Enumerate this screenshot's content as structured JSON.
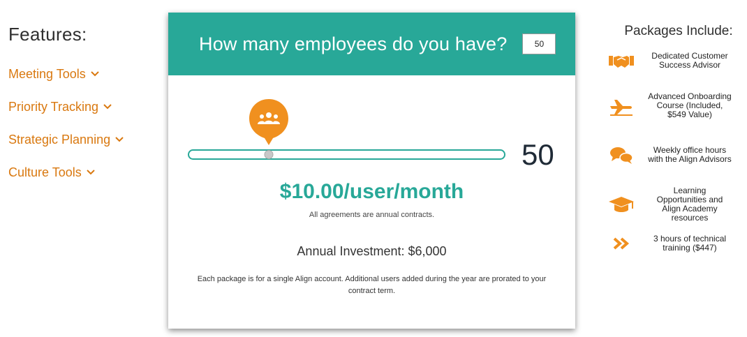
{
  "features": {
    "title": "Features:",
    "items": [
      {
        "label": "Meeting Tools"
      },
      {
        "label": "Priority Tracking"
      },
      {
        "label": "Strategic Planning"
      },
      {
        "label": "Culture Tools"
      }
    ]
  },
  "calculator": {
    "question": "How many employees do you have?",
    "employee_input_value": "50",
    "employee_count_display": "50",
    "slider_fraction": 0.255,
    "price_per_user": "$10.00/user/month",
    "contract_note": "All agreements are annual contracts.",
    "annual_investment": "Annual Investment: $6,000",
    "package_note": "Each package is for a single Align account. Additional users added during the year are prorated to your contract term."
  },
  "packages": {
    "title": "Packages Include:",
    "items": [
      {
        "icon": "handshake-icon",
        "label": "Dedicated Customer Success Advisor"
      },
      {
        "icon": "airplane-icon",
        "label": "Advanced Onboarding Course (Included, $549 Value)"
      },
      {
        "icon": "chat-bubbles-icon",
        "label": "Weekly office hours with the Align Advisors"
      },
      {
        "icon": "graduation-cap-icon",
        "label": "Learning Opportunities and Align Academy resources"
      },
      {
        "icon": "double-chevron-icon",
        "label": "3 hours of technical training ($447)"
      }
    ]
  },
  "colors": {
    "accent_orange": "#d9780f",
    "brand_teal": "#28a898"
  }
}
